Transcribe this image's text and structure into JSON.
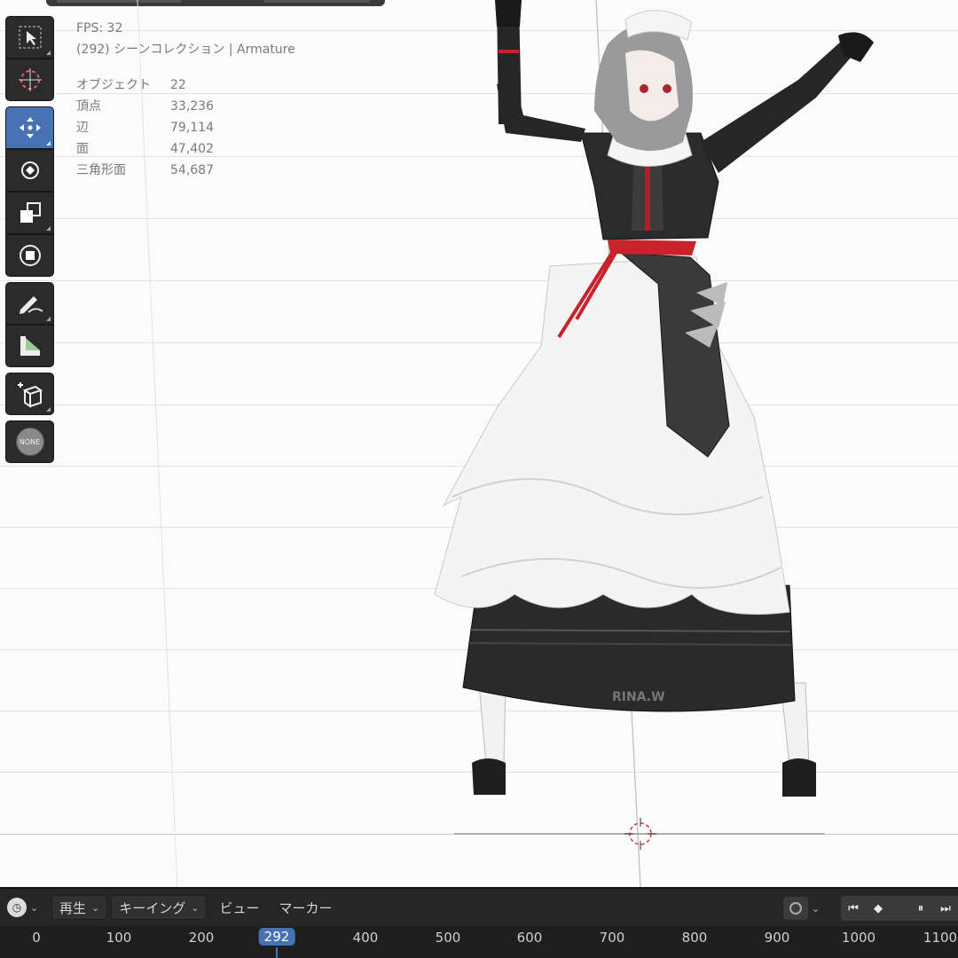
{
  "stats": {
    "fps": "FPS: 32",
    "frame_scene": "(292) シーンコレクション | Armature",
    "rows": [
      {
        "label": "オブジェクト",
        "value": "22"
      },
      {
        "label": "頂点",
        "value": "33,236"
      },
      {
        "label": "辺",
        "value": "79,114"
      },
      {
        "label": "面",
        "value": "47,402"
      },
      {
        "label": "三角形面",
        "value": "54,687"
      }
    ]
  },
  "toolbar": {
    "tools": [
      {
        "name": "select-box-tool",
        "icon": "cursor-select-icon"
      },
      {
        "name": "cursor-tool",
        "icon": "3d-cursor-icon"
      },
      {
        "name": "move-tool",
        "icon": "move-arrows-icon",
        "active": true
      },
      {
        "name": "rotate-tool",
        "icon": "rotate-icon"
      },
      {
        "name": "scale-tool",
        "icon": "scale-icon"
      },
      {
        "name": "transform-tool",
        "icon": "transform-icon"
      },
      {
        "name": "annotate-tool",
        "icon": "pencil-icon"
      },
      {
        "name": "measure-tool",
        "icon": "ruler-icon"
      },
      {
        "name": "add-cube-tool",
        "icon": "add-cube-icon"
      }
    ],
    "none_badge": "NONE"
  },
  "model_text": "RINA.W",
  "timeline": {
    "menus": {
      "playback": "再生",
      "keying": "キーイング",
      "view": "ビュー",
      "marker": "マーカー"
    },
    "ticks": [
      "0",
      "100",
      "200",
      "400",
      "500",
      "600",
      "700",
      "800",
      "900",
      "1000",
      "1100"
    ],
    "current_frame": "292"
  },
  "colors": {
    "accent": "#4772b3",
    "panel": "#262626",
    "ruler": "#1f1f1f"
  }
}
